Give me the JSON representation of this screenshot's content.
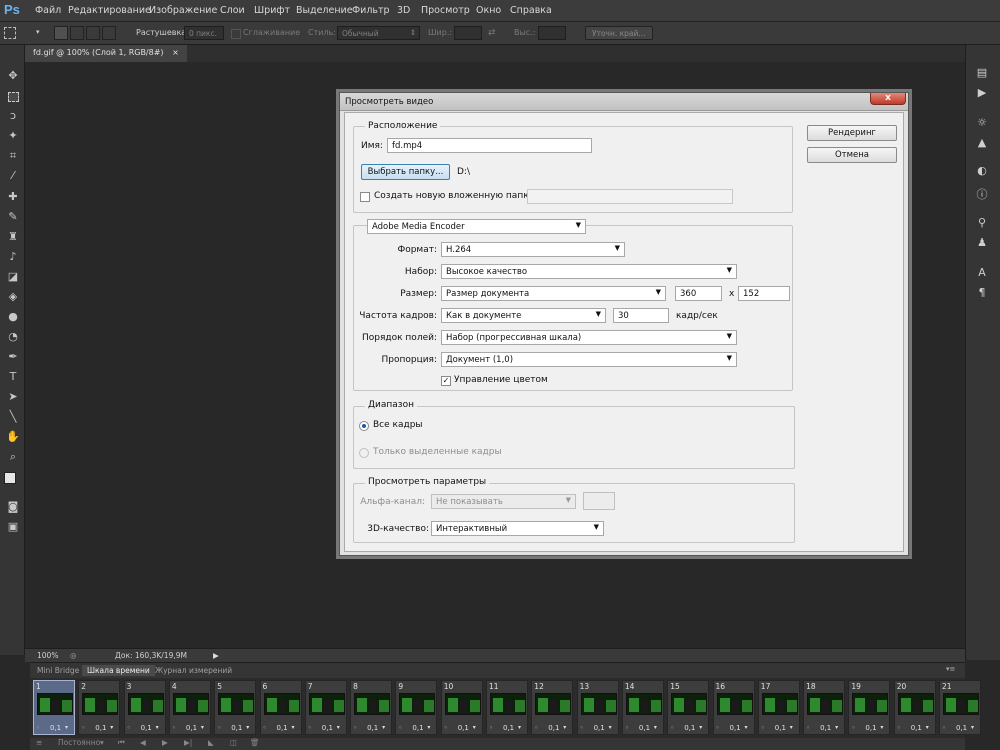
{
  "app": {
    "logo": "Ps"
  },
  "menu": [
    "Файл",
    "Редактирование",
    "Изображение",
    "Слои",
    "Шрифт",
    "Выделение",
    "Фильтр",
    "3D",
    "Просмотр",
    "Окно",
    "Справка"
  ],
  "options_bar": {
    "feather_label": "Растушевка:",
    "feather_value": "0 пикс.",
    "antialias_label": "Сглаживание",
    "style_label": "Стиль:",
    "style_value": "Обычный",
    "width_label": "Шир.:",
    "height_label": "Выс.:",
    "refine_edge": "Уточн. край..."
  },
  "document_tab": {
    "title": "fd.gif @ 100% (Слой 1, RGB/8#)",
    "close": "×"
  },
  "status_bar": {
    "zoom": "100%",
    "doc_info": "Док: 160,3K/19,9M"
  },
  "bottom_panel": {
    "tabs": [
      "Mini Bridge",
      "Шкала времени",
      "Журнал измерений"
    ],
    "active_tab": "Шкала времени",
    "frame_delay": "0,1",
    "loop": "Постоянно",
    "frames": [
      "1",
      "2",
      "3",
      "4",
      "5",
      "6",
      "7",
      "8",
      "9",
      "10",
      "11",
      "12",
      "13",
      "14",
      "15",
      "16",
      "17",
      "18",
      "19",
      "20",
      "21"
    ],
    "selected_frame": "1"
  },
  "dialog": {
    "title": "Просмотреть видео",
    "close": "x",
    "render_button": "Рендеринг",
    "cancel_button": "Отмена",
    "location": {
      "legend": "Расположение",
      "name_label": "Имя:",
      "name_value": "fd.mp4",
      "choose_folder_button": "Выбрать папку...",
      "folder_path": "D:\\",
      "create_subfolder_label": "Создать новую вложенную папку:",
      "create_subfolder_checked": false
    },
    "encoder": {
      "value": "Adobe Media Encoder",
      "format_label": "Формат:",
      "format_value": "H.264",
      "preset_label": "Набор:",
      "preset_value": "Высокое качество",
      "size_label": "Размер:",
      "size_value": "Размер документа",
      "width": "360",
      "x_sep": "x",
      "height": "152",
      "fps_label": "Частота кадров:",
      "fps_value": "Как в документе",
      "fps_number": "30",
      "fps_unit": "кадр/сек",
      "field_order_label": "Порядок полей:",
      "field_order_value": "Набор (прогрессивная шкала)",
      "aspect_label": "Пропорция:",
      "aspect_value": "Документ (1,0)",
      "color_mgmt_label": "Управление цветом",
      "color_mgmt_checked": true
    },
    "range": {
      "legend": "Диапазон",
      "all_frames": "Все кадры",
      "selected_frames": "Только выделенные кадры"
    },
    "render_options": {
      "legend": "Просмотреть параметры",
      "alpha_label": "Альфа-канал:",
      "alpha_value": "Не показывать",
      "quality_label": "3D-качество:",
      "quality_value": "Интерактивный"
    }
  }
}
